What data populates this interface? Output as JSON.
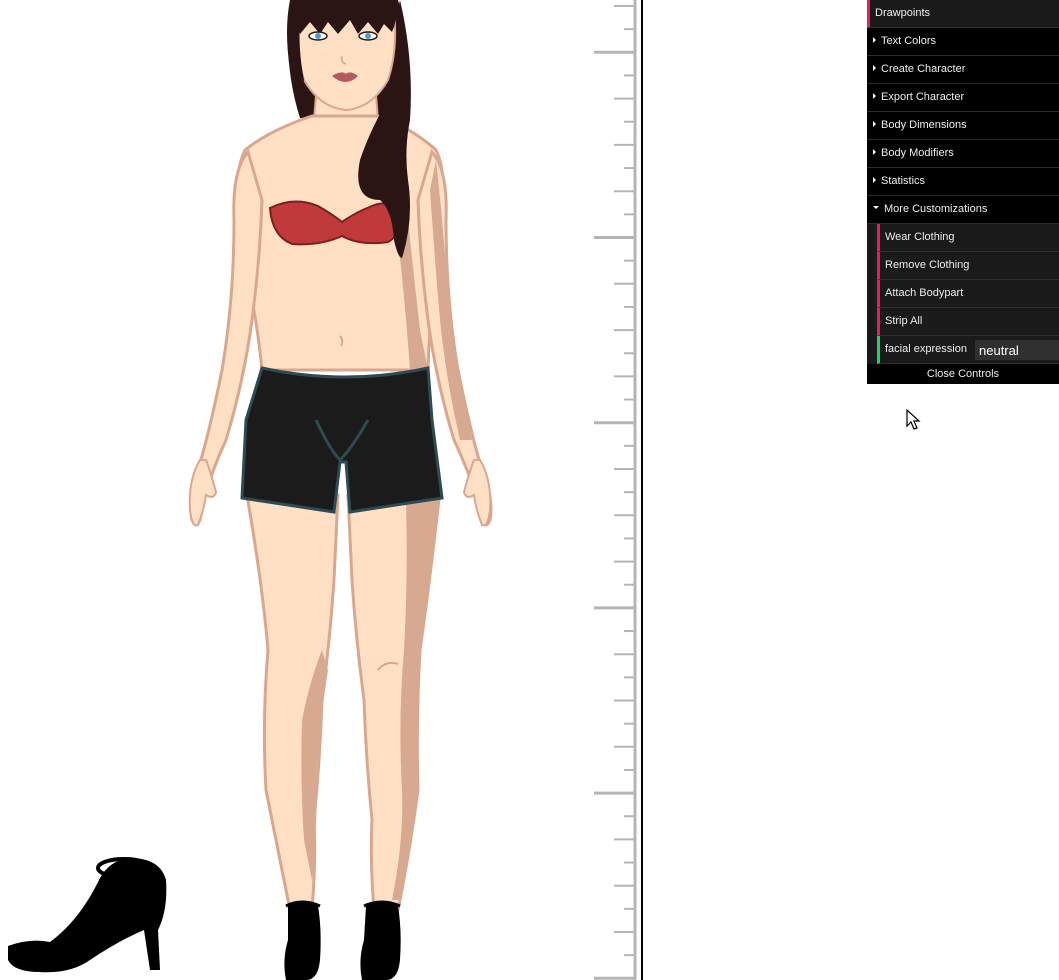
{
  "panel": {
    "drawpoints_label": "Drawpoints",
    "folders": {
      "text_colors": "Text Colors",
      "create_character": "Create Character",
      "export_character": "Export Character",
      "body_dimensions": "Body Dimensions",
      "body_modifiers": "Body Modifiers",
      "statistics": "Statistics",
      "more_customizations": "More Customizations"
    },
    "more_customizations": {
      "wear_clothing": "Wear Clothing",
      "remove_clothing": "Remove Clothing",
      "attach_bodypart": "Attach Bodypart",
      "strip_all": "Strip All",
      "facial_expression_label": "facial expression",
      "facial_expression_value": "neutral"
    },
    "close_label": "Close Controls"
  },
  "colors": {
    "skin": "#ffe0c4",
    "skin_shadow": "#d7a991",
    "skin_outline": "#d9a78f",
    "hair": "#2b1414",
    "bra": "#c0393b",
    "shorts": "#1b1b1b",
    "shorts_outline": "#2e4a52",
    "function_accent": "#e61d5f",
    "string_accent": "#1ed36f",
    "panel_bg": "#1a1a1a"
  },
  "icons": {
    "shoe": "high-heel-icon",
    "cursor": "mouse-pointer-icon"
  }
}
